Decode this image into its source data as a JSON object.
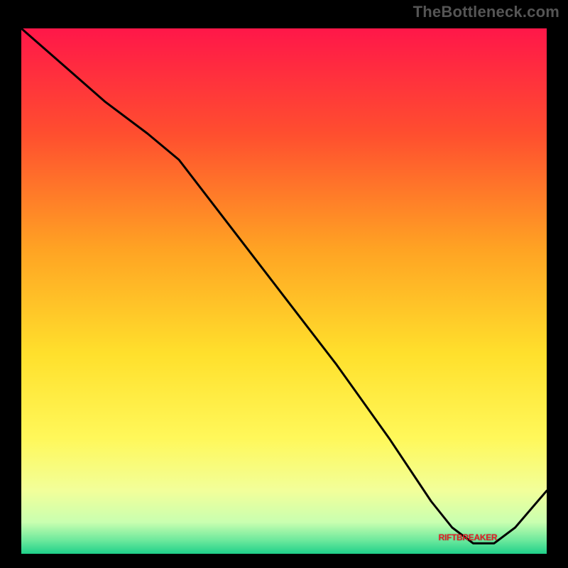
{
  "watermark": "TheBottleneck.com",
  "annotation_label": "RIFTBREAKER",
  "chart_data": {
    "type": "line",
    "title": "",
    "xlabel": "",
    "ylabel": "",
    "xlim": [
      0,
      100
    ],
    "ylim": [
      0,
      100
    ],
    "grid": false,
    "legend": false,
    "annotations": [
      {
        "text": "RIFTBREAKER",
        "x": 84,
        "y": 3
      }
    ],
    "series": [
      {
        "name": "curve",
        "x": [
          0,
          8,
          16,
          24,
          30,
          40,
          50,
          60,
          70,
          78,
          82,
          86,
          90,
          94,
          100
        ],
        "y": [
          100,
          93,
          86,
          80,
          75,
          62,
          49,
          36,
          22,
          10,
          5,
          2,
          2,
          5,
          12
        ]
      }
    ],
    "background_gradient_stops": [
      {
        "pos": 0.0,
        "color": "#ff1749"
      },
      {
        "pos": 0.2,
        "color": "#ff4e2f"
      },
      {
        "pos": 0.42,
        "color": "#ffa323"
      },
      {
        "pos": 0.62,
        "color": "#ffe02c"
      },
      {
        "pos": 0.78,
        "color": "#fff85a"
      },
      {
        "pos": 0.88,
        "color": "#f2ff9a"
      },
      {
        "pos": 0.94,
        "color": "#c9ffb0"
      },
      {
        "pos": 0.975,
        "color": "#6be89c"
      },
      {
        "pos": 1.0,
        "color": "#1fd08a"
      }
    ]
  }
}
